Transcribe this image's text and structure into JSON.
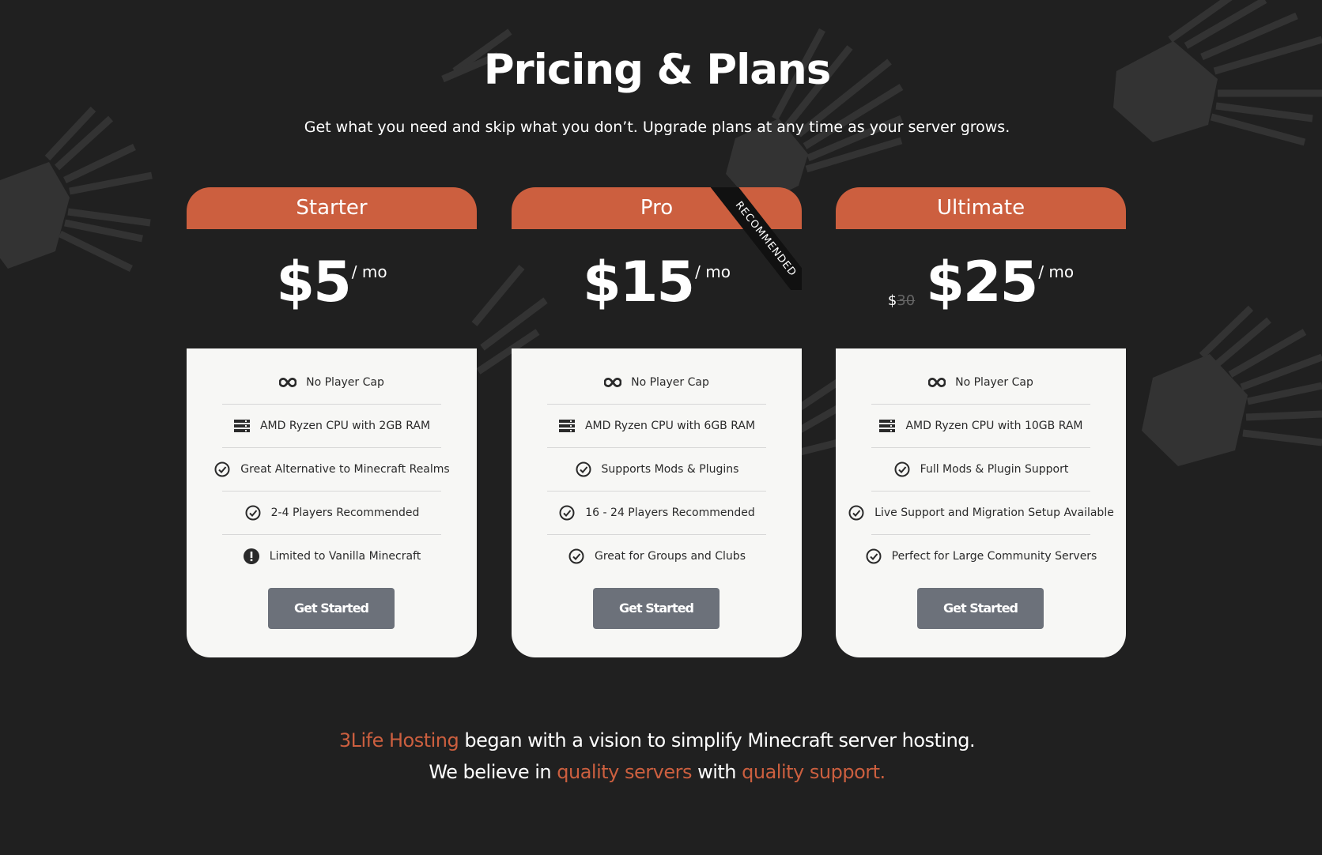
{
  "page": {
    "title": "Pricing & Plans",
    "subtitle": "Get what you need and skip what you don’t. Upgrade plans at any time as your server grows."
  },
  "colors": {
    "background": "#202020",
    "accent": "#cc5f3f",
    "card_body": "#f7f7f5",
    "button": "#6c717a",
    "ribbon": "#111111"
  },
  "plans": [
    {
      "name": "Starter",
      "price": "$5",
      "period": "/ mo",
      "features": [
        {
          "icon": "infinity-icon",
          "text": "No Player Cap"
        },
        {
          "icon": "server-icon",
          "text": "AMD Ryzen CPU with 2GB RAM"
        },
        {
          "icon": "check-circle-icon",
          "text": "Great Alternative to Minecraft Realms"
        },
        {
          "icon": "check-circle-icon",
          "text": "2-4 Players Recommended"
        },
        {
          "icon": "exclamation-circle-icon",
          "text": "Limited to Vanilla Minecraft"
        }
      ],
      "cta": "Get Started"
    },
    {
      "name": "Pro",
      "price": "$15",
      "period": "/ mo",
      "ribbon": "RECOMMENDED",
      "features": [
        {
          "icon": "infinity-icon",
          "text": "No Player Cap"
        },
        {
          "icon": "server-icon",
          "text": "AMD Ryzen CPU with 6GB RAM"
        },
        {
          "icon": "check-circle-icon",
          "text": "Supports Mods & Plugins"
        },
        {
          "icon": "check-circle-icon",
          "text": "16 - 24 Players Recommended"
        },
        {
          "icon": "check-circle-icon",
          "text": "Great for Groups and Clubs"
        }
      ],
      "cta": "Get Started"
    },
    {
      "name": "Ultimate",
      "price": "$25",
      "period": "/ mo",
      "old_price_symbol": "$",
      "old_price_value": "30",
      "features": [
        {
          "icon": "infinity-icon",
          "text": "No Player Cap"
        },
        {
          "icon": "server-icon",
          "text": "AMD Ryzen CPU with 10GB RAM"
        },
        {
          "icon": "check-circle-icon",
          "text": "Full Mods & Plugin Support"
        },
        {
          "icon": "check-circle-icon",
          "text": "Live Support and Migration Setup Available"
        },
        {
          "icon": "check-circle-icon",
          "text": "Perfect for Large Community Servers"
        }
      ],
      "cta": "Get Started"
    }
  ],
  "about": {
    "brand": "3Life Hosting",
    "line1_rest": " began with a vision to simplify Minecraft server hosting.",
    "line2_start": "We believe in ",
    "highlight1": "quality servers",
    "line2_mid": " with ",
    "highlight2": "quality support."
  }
}
